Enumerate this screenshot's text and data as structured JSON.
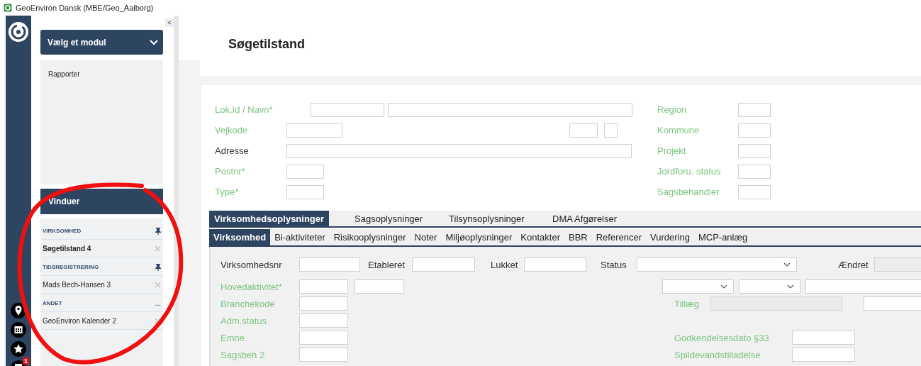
{
  "window": {
    "title": "GeoEnviron Dansk (MBE/Geo_Aalborg)"
  },
  "rail": {
    "badge": "1"
  },
  "module_menu": {
    "label": "Vælg et modul",
    "items": [
      "Rapporter"
    ]
  },
  "collapse_label": "<",
  "windows_panel": {
    "title": "Vinduer",
    "groups": [
      {
        "name": "VIRKSOMHED",
        "kind": "pin",
        "items": [
          {
            "label": "Søgetilstand 4",
            "selected": true
          }
        ]
      },
      {
        "name": "TIDSREGISTRERING",
        "kind": "pin",
        "items": [
          {
            "label": "Mads Bech-Hansen 3",
            "selected": false
          }
        ]
      },
      {
        "name": "ANDET",
        "kind": "more",
        "more_label": "...",
        "items": [
          {
            "label": "GeoEnviron Kalender 2",
            "selected": false
          }
        ]
      }
    ]
  },
  "page_title": "Søgetilstand",
  "search_form": {
    "rows": [
      {
        "cells": [
          {
            "kind": "label",
            "text": "Lok.Id / Navn*",
            "emphasis": true
          },
          {
            "kind": "input"
          },
          {
            "kind": "input"
          },
          {
            "kind": "label",
            "text": "Region",
            "emphasis": true
          },
          {
            "kind": "input"
          }
        ]
      },
      {
        "cells": [
          {
            "kind": "label",
            "text": "Vejkode",
            "emphasis": true
          },
          {
            "kind": "input"
          },
          {
            "kind": "input"
          },
          {
            "kind": "input"
          },
          {
            "kind": "label",
            "text": "Kommune",
            "emphasis": true
          },
          {
            "kind": "input"
          }
        ]
      },
      {
        "cells": [
          {
            "kind": "label",
            "text": "Adresse",
            "emphasis": false
          },
          {
            "kind": "input"
          },
          {
            "kind": "label",
            "text": "Projekt",
            "emphasis": true
          },
          {
            "kind": "input"
          }
        ]
      },
      {
        "cells": [
          {
            "kind": "label",
            "text": "Postnr*",
            "emphasis": true
          },
          {
            "kind": "input"
          },
          {
            "kind": "label",
            "text": "Jordforu. status",
            "emphasis": true
          },
          {
            "kind": "input"
          }
        ]
      },
      {
        "cells": [
          {
            "kind": "label",
            "text": "Type*",
            "emphasis": true
          },
          {
            "kind": "input"
          },
          {
            "kind": "label",
            "text": "Sagsbehandler",
            "emphasis": true
          },
          {
            "kind": "input"
          }
        ]
      }
    ]
  },
  "tabs": [
    {
      "label": "Virksomhedsoplysninger",
      "selected": true
    },
    {
      "label": "Sagsoplysninger",
      "selected": false
    },
    {
      "label": "Tilsynsoplysninger",
      "selected": false
    },
    {
      "label": "DMA Afgørelser",
      "selected": false
    }
  ],
  "subtabs": [
    {
      "label": "Virksomhed",
      "selected": true
    },
    {
      "label": "Bi-aktiviteter",
      "selected": false
    },
    {
      "label": "Risikooplysninger",
      "selected": false
    },
    {
      "label": "Noter",
      "selected": false
    },
    {
      "label": "Miljøoplysninger",
      "selected": false
    },
    {
      "label": "Kontakter",
      "selected": false
    },
    {
      "label": "BBR",
      "selected": false
    },
    {
      "label": "Referencer",
      "selected": false
    },
    {
      "label": "Vurdering",
      "selected": false
    },
    {
      "label": "MCP-anlæg",
      "selected": false
    }
  ],
  "detail_form": {
    "rows": [
      {
        "cells": [
          {
            "kind": "label",
            "text": "Virksomhedsnr",
            "emphasis": false
          },
          {
            "kind": "input"
          },
          {
            "kind": "label",
            "text": "Etableret",
            "emphasis": false
          },
          {
            "kind": "input"
          },
          {
            "kind": "label",
            "text": "Lukket",
            "emphasis": false
          },
          {
            "kind": "input"
          },
          {
            "kind": "label",
            "text": "Status",
            "emphasis": false
          },
          {
            "kind": "select"
          },
          {
            "kind": "label",
            "text": "Ændret",
            "emphasis": false
          },
          {
            "kind": "input",
            "disabled": true
          }
        ]
      },
      {
        "cells": [
          {
            "kind": "label",
            "text": "Hovedaktivitet*",
            "emphasis": true
          },
          {
            "kind": "input"
          },
          {
            "kind": "input"
          },
          {
            "kind": "select"
          },
          {
            "kind": "select"
          },
          {
            "kind": "input"
          }
        ]
      },
      {
        "cells": [
          {
            "kind": "label",
            "text": "Branchekode",
            "emphasis": true
          },
          {
            "kind": "input"
          },
          {
            "kind": "label",
            "text": "Tillæg",
            "emphasis": true
          },
          {
            "kind": "input",
            "disabled": true
          },
          {
            "kind": "input"
          }
        ]
      },
      {
        "cells": [
          {
            "kind": "label",
            "text": "Adm.status",
            "emphasis": true
          },
          {
            "kind": "input"
          }
        ]
      },
      {
        "cells": [
          {
            "kind": "label",
            "text": "Emne",
            "emphasis": true
          },
          {
            "kind": "input"
          },
          {
            "kind": "label",
            "text": "Godkendelsesdato §33",
            "emphasis": true
          },
          {
            "kind": "input"
          }
        ]
      },
      {
        "cells": [
          {
            "kind": "label",
            "text": "Sagsbeh 2",
            "emphasis": true
          },
          {
            "kind": "input"
          },
          {
            "kind": "label",
            "text": "Spildevandstilladelse",
            "emphasis": true
          },
          {
            "kind": "input"
          }
        ]
      }
    ]
  }
}
